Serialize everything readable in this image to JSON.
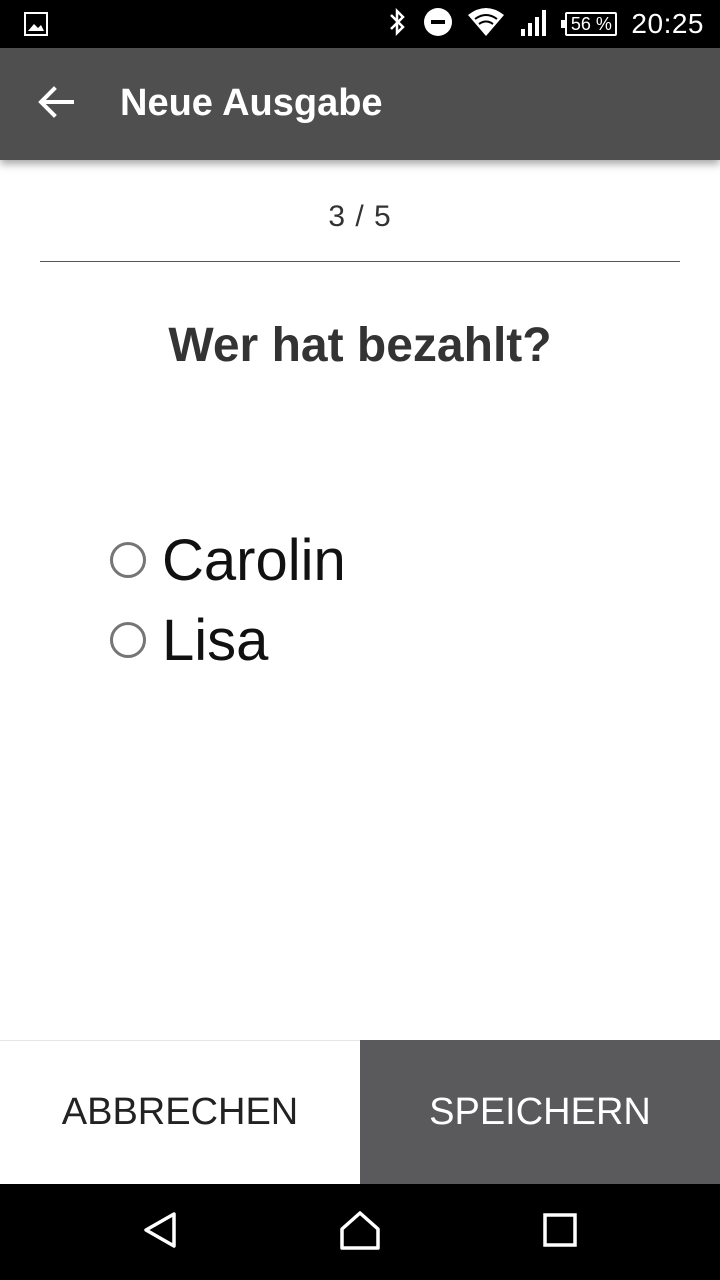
{
  "status_bar": {
    "time": "20:25",
    "battery": "56 %",
    "icons": [
      "gallery-icon",
      "bluetooth-icon",
      "do-not-disturb-icon",
      "wifi-icon",
      "signal-icon",
      "battery-icon"
    ]
  },
  "app_bar": {
    "title": "Neue Ausgabe",
    "back_icon": "arrow-back-icon"
  },
  "wizard": {
    "step": "3 / 5",
    "question": "Wer hat bezahlt?",
    "options": [
      {
        "label": "Carolin",
        "selected": false
      },
      {
        "label": "Lisa",
        "selected": false
      }
    ]
  },
  "actions": {
    "cancel_label": "ABBRECHEN",
    "save_label": "SPEICHERN"
  },
  "nav_bar": {
    "icons": [
      "back-triangle-icon",
      "home-icon",
      "recents-icon"
    ]
  },
  "colors": {
    "app_bar": "#4f4f4f",
    "save_button": "#5a5a5c",
    "status_bar": "#000000"
  }
}
